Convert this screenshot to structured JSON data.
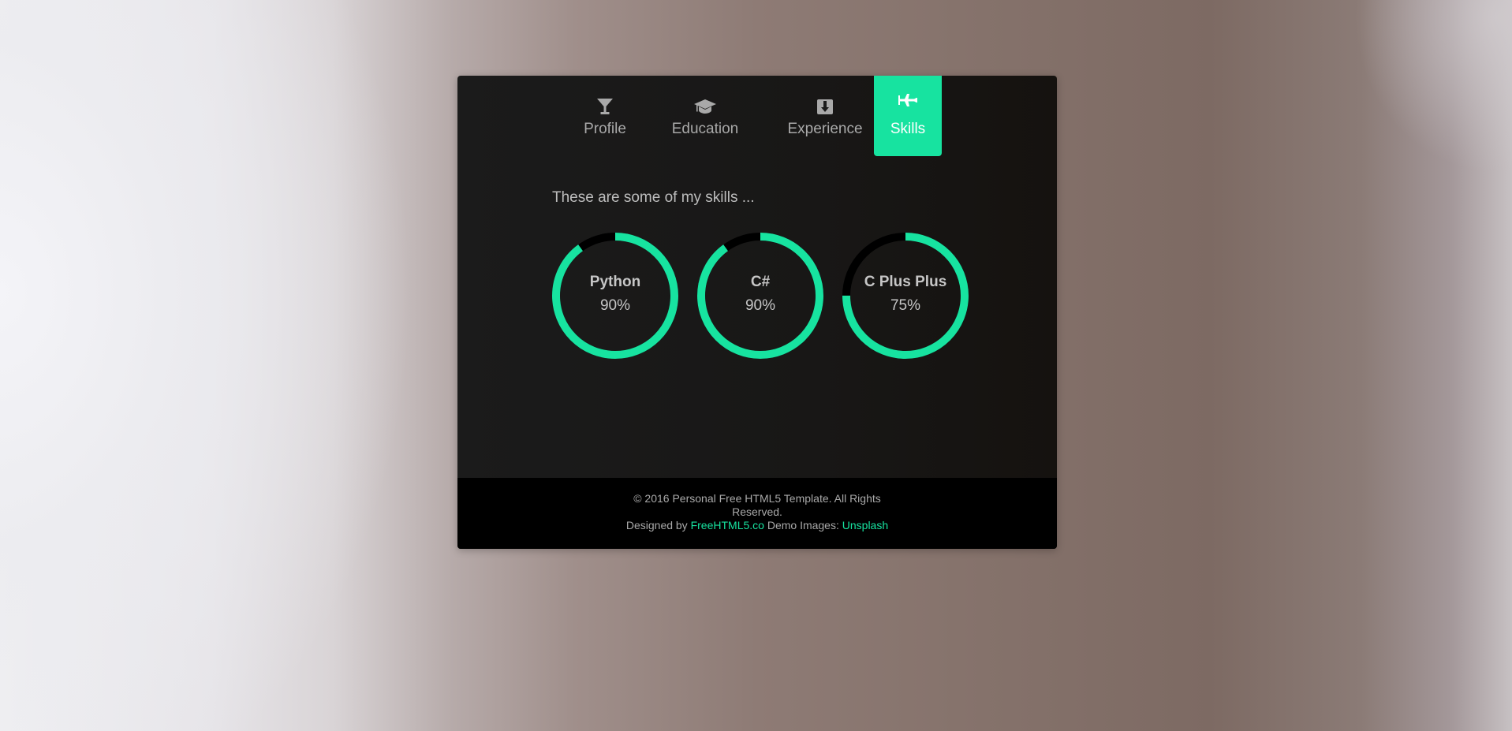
{
  "nav": {
    "tabs": [
      {
        "label": "Profile",
        "icon": "martini-glass-icon"
      },
      {
        "label": "Education",
        "icon": "graduation-cap-icon"
      },
      {
        "label": "Experience",
        "icon": "suitcase-icon"
      },
      {
        "label": "Skills",
        "icon": "airplane-icon",
        "active": true
      }
    ]
  },
  "skills": {
    "intro": "These are some of my skills ...",
    "items": [
      {
        "name": "Python",
        "percent_label": "90%",
        "percent": 90
      },
      {
        "name": "C#",
        "percent_label": "90%",
        "percent": 90
      },
      {
        "name": "C Plus Plus",
        "percent_label": "75%",
        "percent": 75
      }
    ]
  },
  "footer": {
    "copyright_line1": "© 2016 Personal Free HTML5 Template. All Rights",
    "copyright_line2": "Reserved.",
    "designed_by_prefix": "Designed by",
    "designed_by_link": "FreeHTML5.co",
    "demo_images_prefix": "Demo Images:",
    "demo_images_link": "Unsplash"
  },
  "colors": {
    "accent": "#17e3a0",
    "track": "#000000",
    "card_bg": "#1b1b1b",
    "footer_bg": "#000000"
  }
}
